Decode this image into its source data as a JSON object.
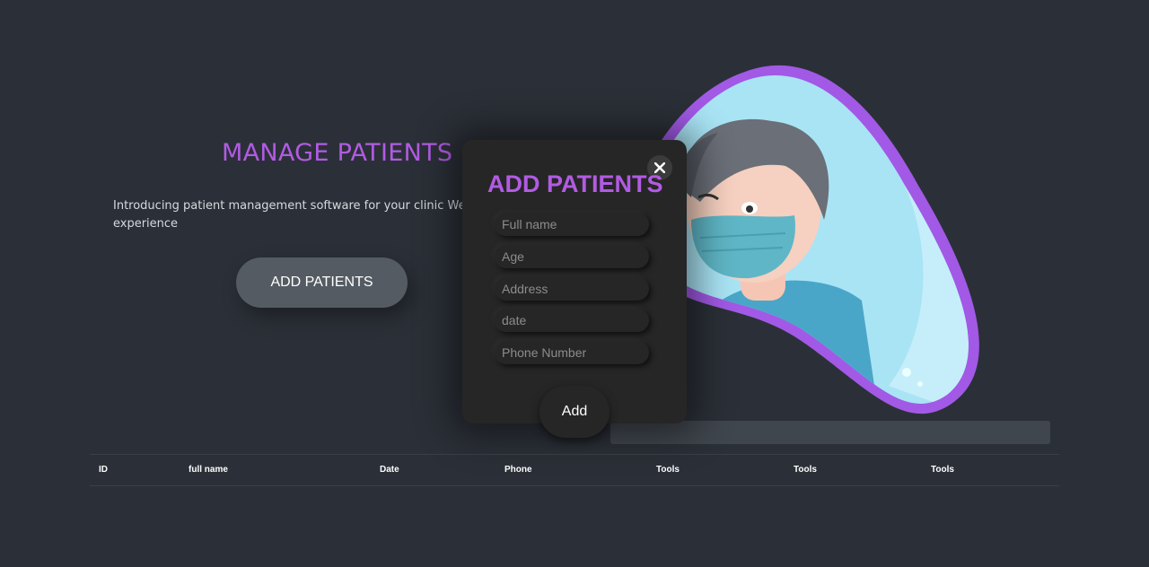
{
  "hero": {
    "title": "MANAGE PATIENTS",
    "description_line1": "Introducing patient management software for your clinic We wish",
    "description_line2": "experience",
    "button_label": "ADD PATIENTS"
  },
  "table": {
    "headers": [
      "ID",
      "full name",
      "Date",
      "Phone",
      "Tools",
      "Tools",
      "Tools"
    ]
  },
  "modal": {
    "title": "ADD PATIENTS",
    "close_icon": "close-icon",
    "fields": {
      "full_name_placeholder": "Full name",
      "age_placeholder": "Age",
      "address_placeholder": "Address",
      "date_placeholder": "date",
      "phone_placeholder": "Phone Number"
    },
    "submit_label": "Add"
  },
  "colors": {
    "accent": "#b25be3",
    "background": "#2b3038",
    "modal_bg": "#262626"
  }
}
